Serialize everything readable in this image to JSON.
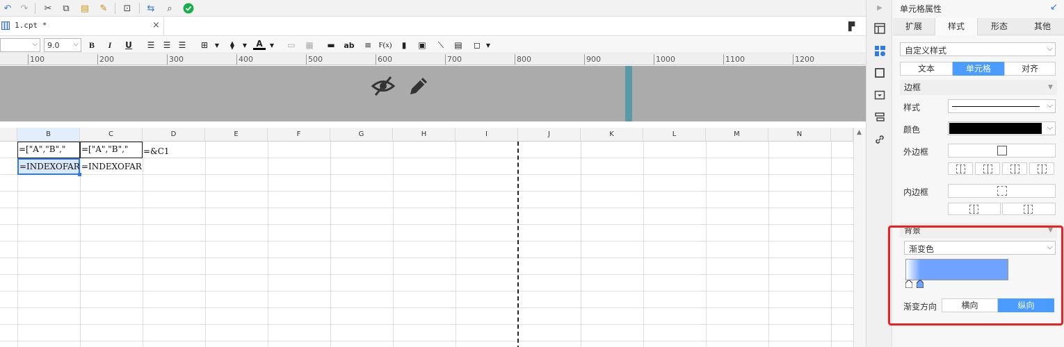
{
  "tab": {
    "file_name": "1.cpt *",
    "close": "×"
  },
  "format_toolbar": {
    "font_size": "9.0",
    "bold": "B",
    "italic": "I",
    "underline": "U",
    "font_color_letter": "A",
    "text_icon": "ab",
    "formula_icon": "F(x)"
  },
  "ruler": {
    "ticks": [
      "100",
      "200",
      "300",
      "400",
      "500",
      "600",
      "700",
      "800",
      "900",
      "1000",
      "1100",
      "1200"
    ]
  },
  "grid": {
    "columns": [
      "B",
      "C",
      "D",
      "E",
      "F",
      "G",
      "H",
      "I",
      "J",
      "K",
      "L",
      "M",
      "N"
    ],
    "cells": {
      "b1": "=[\"A\",\"B\",\"",
      "c1": "=[\"A\",\"B\",\"",
      "d1": "=&C1",
      "b2": "=INDEXOFARR",
      "c2": "=INDEXOFARR"
    }
  },
  "panel": {
    "title": "单元格属性",
    "tabs": [
      "扩展",
      "样式",
      "形态",
      "其他"
    ],
    "active_tab": "样式",
    "style_select": "自定义样式",
    "subtabs": [
      "文本",
      "单元格",
      "对齐"
    ],
    "active_subtab": "单元格",
    "border_section": "边框",
    "labels": {
      "style": "样式",
      "color": "颜色",
      "outer": "外边框",
      "inner": "内边框"
    },
    "background_section": "背景",
    "background_select": "渐变色",
    "gradient_direction_label": "渐变方向",
    "direction_options": [
      "横向",
      "纵向"
    ],
    "active_direction": "纵向"
  },
  "colors": {
    "accent": "#4b9cff",
    "highlight": "#f01e1e",
    "gradient_end": "#6fa3ff",
    "band": "#ababab",
    "border_color": "#000000"
  }
}
